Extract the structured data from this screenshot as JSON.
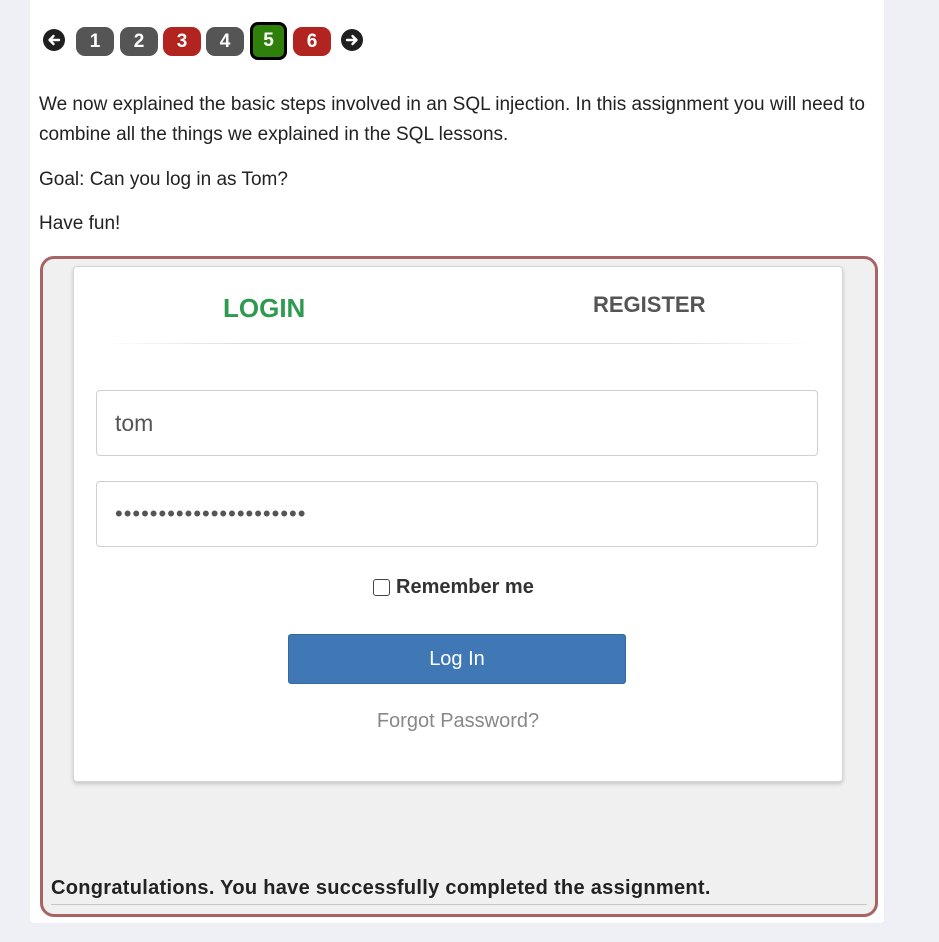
{
  "pagination": {
    "prev_icon": "arrow-left-icon",
    "next_icon": "arrow-right-icon",
    "pages": [
      {
        "label": "1",
        "status": "gray",
        "color": "#555555"
      },
      {
        "label": "2",
        "status": "gray",
        "color": "#555555"
      },
      {
        "label": "3",
        "status": "red",
        "color": "#b1241f"
      },
      {
        "label": "4",
        "status": "gray",
        "color": "#555555"
      },
      {
        "label": "5",
        "status": "current",
        "color": "#2f7f0b"
      },
      {
        "label": "6",
        "status": "red",
        "color": "#b1241f"
      }
    ]
  },
  "lesson": {
    "intro": "We now explained the basic steps involved in an SQL injection. In this assignment you will need to combine all the things we explained in the SQL lessons.",
    "goal": "Goal: Can you log in as Tom?",
    "closing": "Have fun!"
  },
  "login_form": {
    "tab_login": "LOGIN",
    "tab_register": "REGISTER",
    "username_value": "tom",
    "password_value": "••••••••••••••••••••••",
    "remember_label": "Remember me",
    "remember_checked": false,
    "login_button": "Log In",
    "forgot_link": "Forgot Password?"
  },
  "feedback": {
    "message": "Congratulations. You have successfully completed the assignment."
  },
  "colors": {
    "accent_green": "#2e9a4f",
    "button_blue": "#3f78b4",
    "container_border": "#a86464"
  }
}
